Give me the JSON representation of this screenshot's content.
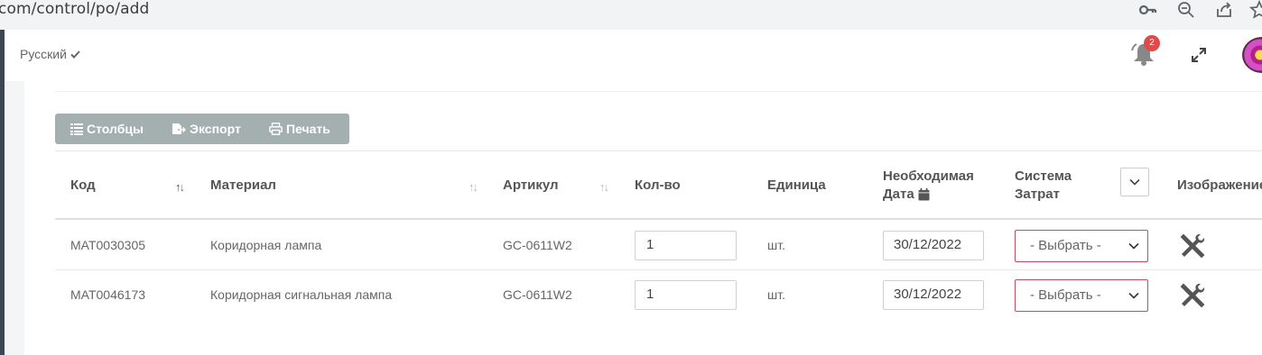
{
  "browser": {
    "url": "com/control/po/add",
    "icons": [
      "key-icon",
      "zoom-out-icon",
      "share-icon",
      "star-icon"
    ]
  },
  "topbar": {
    "language": "Русский",
    "notification_count": "2",
    "icons": [
      "bell-icon",
      "expand-icon",
      "avatar"
    ]
  },
  "toolbar": {
    "columns_label": "Столбцы",
    "export_label": "Экспорт",
    "print_label": "Печать"
  },
  "table": {
    "headers": {
      "code": "Код",
      "material": "Материал",
      "article": "Артикул",
      "qty": "Кол-во",
      "unit": "Единица",
      "date_line1": "Необходимая",
      "date_line2": "Дата",
      "cost_line1": "Система",
      "cost_line2": "Затрат",
      "image": "Изображение"
    },
    "rows": [
      {
        "code": "MAT0030305",
        "material": "Коридорная лампа",
        "article": "GC-0611W2",
        "qty": "1",
        "unit": "шт.",
        "date": "30/12/2022",
        "cost_system": "- Выбрать -"
      },
      {
        "code": "MAT0046173",
        "material": "Коридорная сигнальная лампа",
        "article": "GC-0611W2",
        "qty": "1",
        "unit": "шт.",
        "date": "30/12/2022",
        "cost_system": "- Выбрать -"
      }
    ]
  },
  "colors": {
    "toolbar_bg": "#a4b0af",
    "select_border_error": "#d2485a",
    "badge": "#e04a4a",
    "sidebar": "#3d4650"
  }
}
